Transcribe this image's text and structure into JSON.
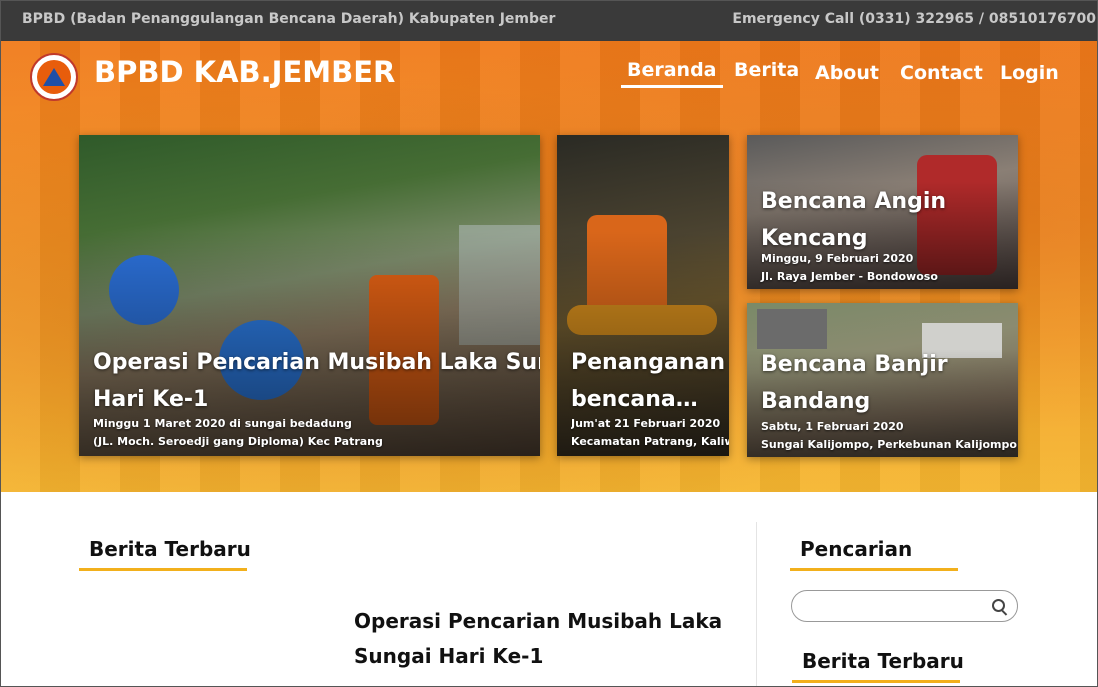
{
  "topbar": {
    "org_name": "BPBD (Badan Penanggulangan Bencana Daerah) Kabupaten Jember",
    "emergency": "Emergency Call (0331) 322965 / 08510176700"
  },
  "header": {
    "brand": "BPBD KAB.JEMBER",
    "logo_icon": "bpbd-logo-icon",
    "nav": [
      {
        "label": "Beranda",
        "active": true
      },
      {
        "label": "Berita",
        "active": false
      },
      {
        "label": "About",
        "active": false
      },
      {
        "label": "Contact",
        "active": false
      },
      {
        "label": "Login",
        "active": false
      }
    ]
  },
  "featured": [
    {
      "title_line1": "Operasi Pencarian Musibah Laka Sungai",
      "title_line2": "Hari Ke-1",
      "date": "Minggu 1 Maret 2020 di sungai bedadung",
      "location": "(JL. Moch. Seroedji gang Diploma) Kec Patrang"
    },
    {
      "title_line1": "Penanganan",
      "title_line2": "bencana…",
      "date": "Jum'at 21 Februari 2020",
      "location": "Kecamatan Patrang, Kaliwa…"
    },
    {
      "title_line1": "Bencana Angin",
      "title_line2": "Kencang",
      "date": "Minggu, 9 Februari 2020",
      "location": "Jl. Raya Jember - Bondowoso"
    },
    {
      "title_line1": "Bencana Banjir",
      "title_line2": "Bandang",
      "date": "Sabtu, 1 Februari 2020",
      "location": "Sungai Kalijompo, Perkebunan Kalijompo"
    }
  ],
  "main": {
    "latest_heading": "Berita Terbaru",
    "article_title_line1": "Operasi Pencarian Musibah Laka",
    "article_title_line2": "Sungai Hari Ke-1"
  },
  "sidebar": {
    "search_heading": "Pencarian",
    "search_placeholder": "",
    "search_icon": "search-icon",
    "latest_heading": "Berita Terbaru"
  },
  "colors": {
    "topbar_bg": "#3a3a3a",
    "hero_orange": "#f07a1a",
    "hero_yellow": "#f5b630",
    "accent_underline": "#f2b01c"
  }
}
